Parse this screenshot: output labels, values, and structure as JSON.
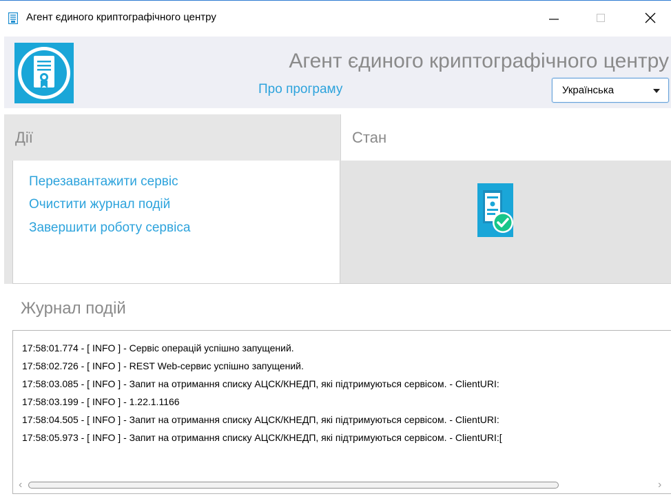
{
  "window": {
    "title": "Агент єдиного криптографічного центру"
  },
  "header": {
    "app_title": "Агент єдиного криптографічного центру",
    "about_link": "Про програму",
    "language": {
      "selected": "Українська"
    }
  },
  "actions": {
    "title": "Дії",
    "items": [
      {
        "label": "Перезавантажити сервіс"
      },
      {
        "label": "Очистити журнал подій"
      },
      {
        "label": "Завершити роботу сервіса"
      }
    ]
  },
  "state": {
    "title": "Стан",
    "icon": "certificate-check-icon"
  },
  "log": {
    "title": "Журнал подій",
    "lines": [
      "17:58:01.774 - [ INFO ] - Сервіс операцій успішно запущений.",
      "17:58:02.726 - [ INFO ] - REST Web-сервис успішно запущений.",
      "17:58:03.085 - [ INFO ] - Запит на отримання списку АЦСК/КНЕДП, які підтримуються сервісом. - ClientURI:",
      "17:58:03.199 - [ INFO ] - 1.22.1.1166",
      "17:58:04.505 - [ INFO ] - Запит на отримання списку АЦСК/КНЕДП, які підтримуються сервісом. - ClientURI:",
      "17:58:05.973 - [ INFO ] - Запит на отримання списку АЦСК/КНЕДП, які підтримуються сервісом. - ClientURI:["
    ]
  },
  "colors": {
    "link": "#2da3dc",
    "header_bg": "#eeeff5",
    "panel_gray": "#e6e6e6",
    "icon_teal": "#1aa6d8",
    "check_green": "#17c68a"
  }
}
